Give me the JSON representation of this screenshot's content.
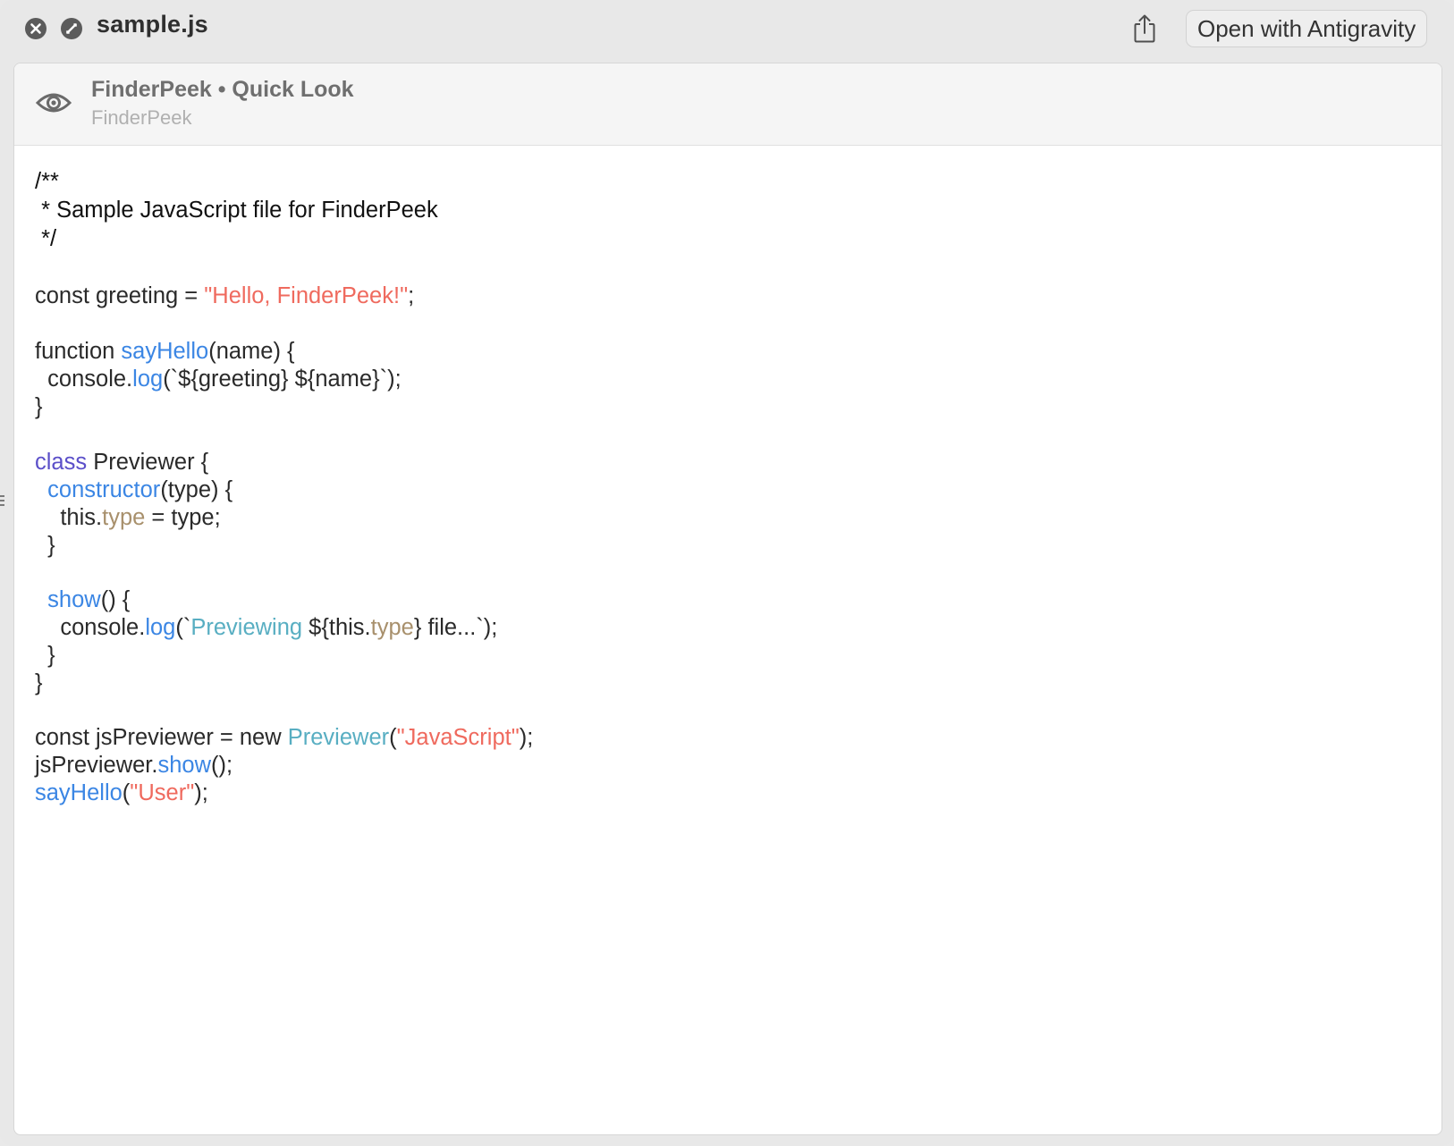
{
  "titlebar": {
    "file_name": "sample.js",
    "open_with_label": "Open with Antigravity",
    "icons": {
      "close": "close-icon",
      "fullscreen": "fullscreen-icon",
      "share": "share-icon"
    }
  },
  "preview_header": {
    "title": "FinderPeek • Quick Look",
    "subtitle": "FinderPeek",
    "icon": "eye-icon"
  },
  "colors": {
    "string": "#ef6a5e",
    "function": "#3b86e4",
    "keyword": "#5b4fc9",
    "property": "#a8906c",
    "type": "#58aec2",
    "plain": "#2a2a2a"
  },
  "code": {
    "language": "JavaScript",
    "lines": [
      [
        {
          "t": "/**",
          "k": "comment"
        }
      ],
      [
        {
          "t": " * Sample JavaScript file for FinderPeek",
          "k": "comment"
        }
      ],
      [
        {
          "t": " */",
          "k": "comment"
        }
      ],
      [],
      [
        {
          "t": "const greeting = ",
          "k": "plain"
        },
        {
          "t": "\"Hello, FinderPeek!\"",
          "k": "string"
        },
        {
          "t": ";",
          "k": "plain"
        }
      ],
      [],
      [
        {
          "t": "function ",
          "k": "plain"
        },
        {
          "t": "sayHello",
          "k": "func"
        },
        {
          "t": "(name) {",
          "k": "plain"
        }
      ],
      [
        {
          "t": "  console.",
          "k": "plain"
        },
        {
          "t": "log",
          "k": "func"
        },
        {
          "t": "(`${greeting} ${name}`);",
          "k": "plain"
        }
      ],
      [
        {
          "t": "}",
          "k": "plain"
        }
      ],
      [],
      [
        {
          "t": "class",
          "k": "keyword"
        },
        {
          "t": " Previewer {",
          "k": "plain"
        }
      ],
      [
        {
          "t": "  ",
          "k": "plain"
        },
        {
          "t": "constructor",
          "k": "func"
        },
        {
          "t": "(type) {",
          "k": "plain"
        }
      ],
      [
        {
          "t": "    this.",
          "k": "plain"
        },
        {
          "t": "type",
          "k": "prop"
        },
        {
          "t": " = type;",
          "k": "plain"
        }
      ],
      [
        {
          "t": "  }",
          "k": "plain"
        }
      ],
      [],
      [
        {
          "t": "  ",
          "k": "plain"
        },
        {
          "t": "show",
          "k": "func"
        },
        {
          "t": "() {",
          "k": "plain"
        }
      ],
      [
        {
          "t": "    console.",
          "k": "plain"
        },
        {
          "t": "log",
          "k": "func"
        },
        {
          "t": "(`",
          "k": "plain"
        },
        {
          "t": "Previewing",
          "k": "template"
        },
        {
          "t": " ${this.",
          "k": "plain"
        },
        {
          "t": "type",
          "k": "prop"
        },
        {
          "t": "} file...`);",
          "k": "plain"
        }
      ],
      [
        {
          "t": "  }",
          "k": "plain"
        }
      ],
      [
        {
          "t": "}",
          "k": "plain"
        }
      ],
      [],
      [
        {
          "t": "const jsPreviewer = new ",
          "k": "plain"
        },
        {
          "t": "Previewer",
          "k": "type"
        },
        {
          "t": "(",
          "k": "plain"
        },
        {
          "t": "\"JavaScript\"",
          "k": "string"
        },
        {
          "t": ");",
          "k": "plain"
        }
      ],
      [
        {
          "t": "jsPreviewer.",
          "k": "plain"
        },
        {
          "t": "show",
          "k": "func"
        },
        {
          "t": "();",
          "k": "plain"
        }
      ],
      [
        {
          "t": "sayHello",
          "k": "func"
        },
        {
          "t": "(",
          "k": "plain"
        },
        {
          "t": "\"User\"",
          "k": "string"
        },
        {
          "t": ");",
          "k": "plain"
        }
      ]
    ]
  }
}
